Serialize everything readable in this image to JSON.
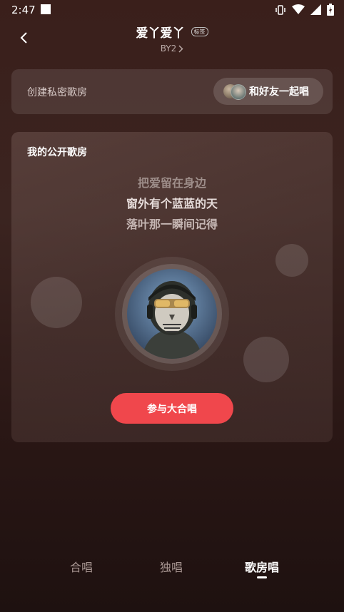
{
  "status_bar": {
    "time": "2:47",
    "icons": [
      "notification-square-icon",
      "vibrate-icon",
      "wifi-icon",
      "signal-icon",
      "battery-icon"
    ]
  },
  "header": {
    "title": "爱丫爱丫",
    "tag": "标签",
    "subtitle": "BY2"
  },
  "private_room": {
    "label": "创建私密歌房",
    "button_label": "和好友一起唱"
  },
  "public_room": {
    "title": "我的公开歌房",
    "lyrics": [
      "把爱留在身边",
      "窗外有个蓝蓝的天",
      "落叶那一瞬间记得"
    ],
    "join_label": "参与大合唱"
  },
  "tabs": {
    "items": [
      {
        "label": "合唱"
      },
      {
        "label": "独唱"
      },
      {
        "label": "歌房唱"
      }
    ],
    "active_index": 2
  },
  "colors": {
    "accent": "#f0474c",
    "background_top": "#3a1f1b",
    "background_bottom": "#1e1110"
  }
}
